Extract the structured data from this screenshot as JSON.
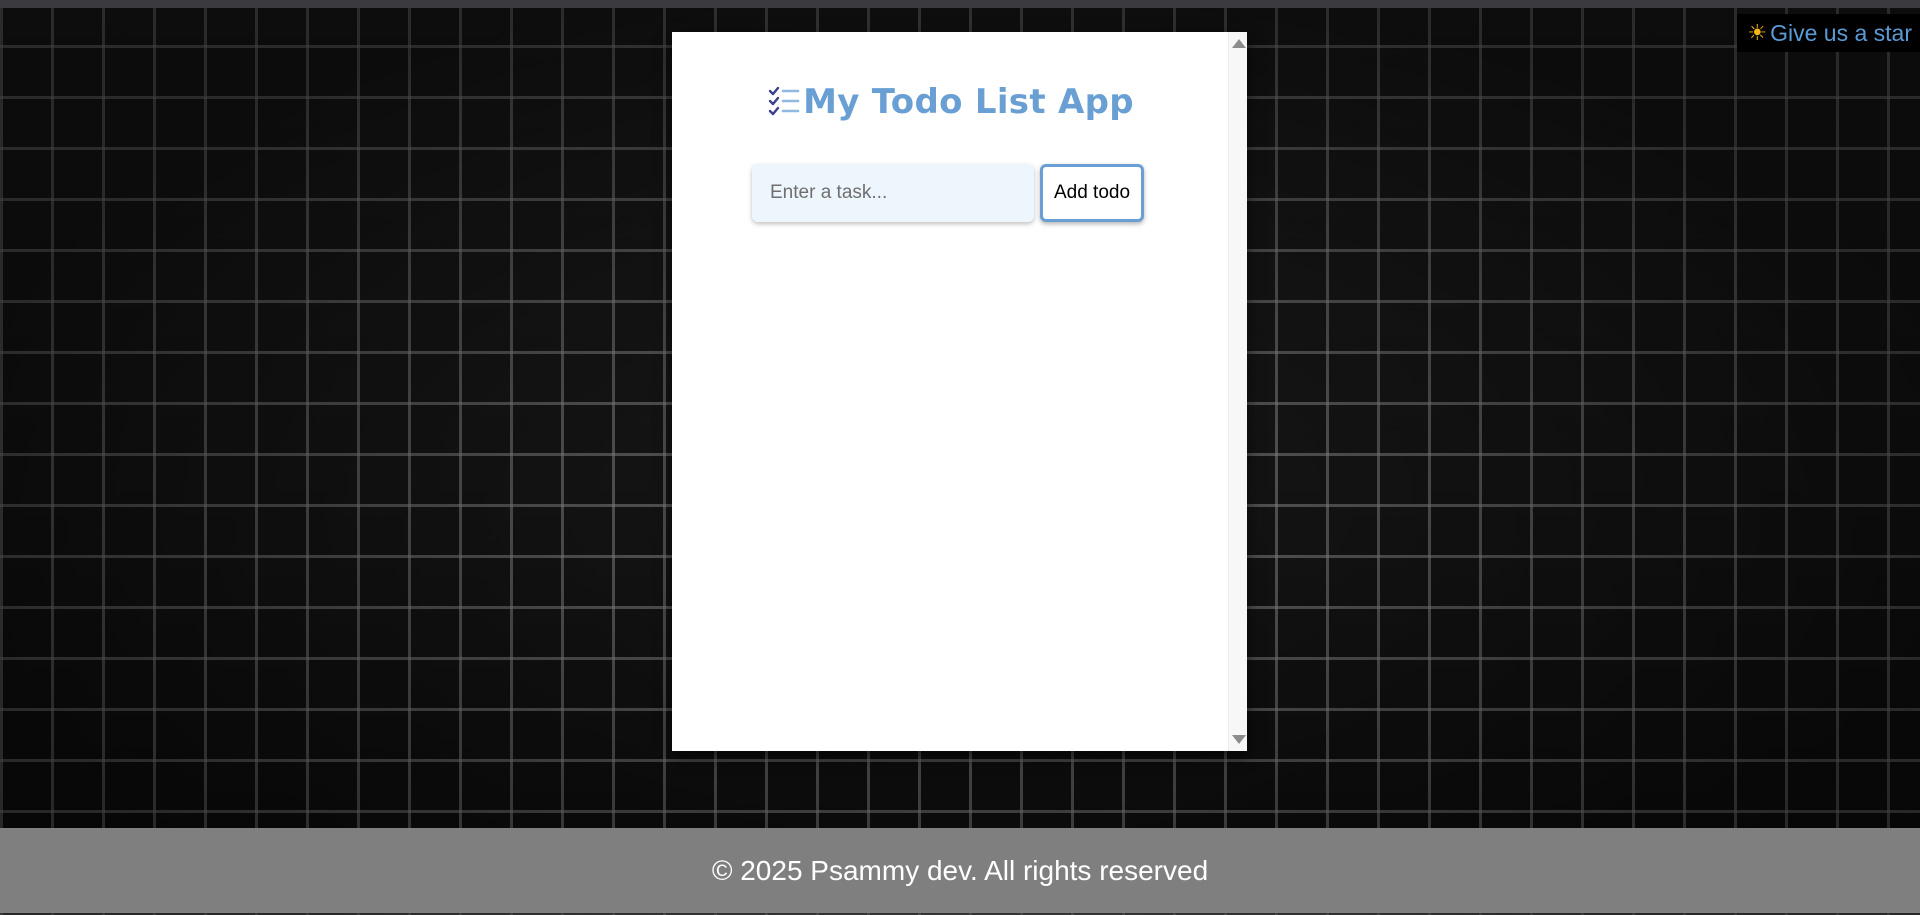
{
  "app": {
    "title": "My Todo List App",
    "icon": "checklist-icon"
  },
  "input": {
    "placeholder": "Enter a task...",
    "value": ""
  },
  "add_button": {
    "label": "Add todo"
  },
  "star_link": {
    "icon": "sun-icon",
    "label": "Give us a star"
  },
  "footer": {
    "text": "© 2025 Psammy dev. All rights reserved"
  },
  "todos": [],
  "colors": {
    "accent": "#6a9fd4",
    "link": "#5b9bd5",
    "sun": "#f5b417",
    "footer_bg": "#7f7f7f",
    "input_bg": "#eef6fd"
  }
}
